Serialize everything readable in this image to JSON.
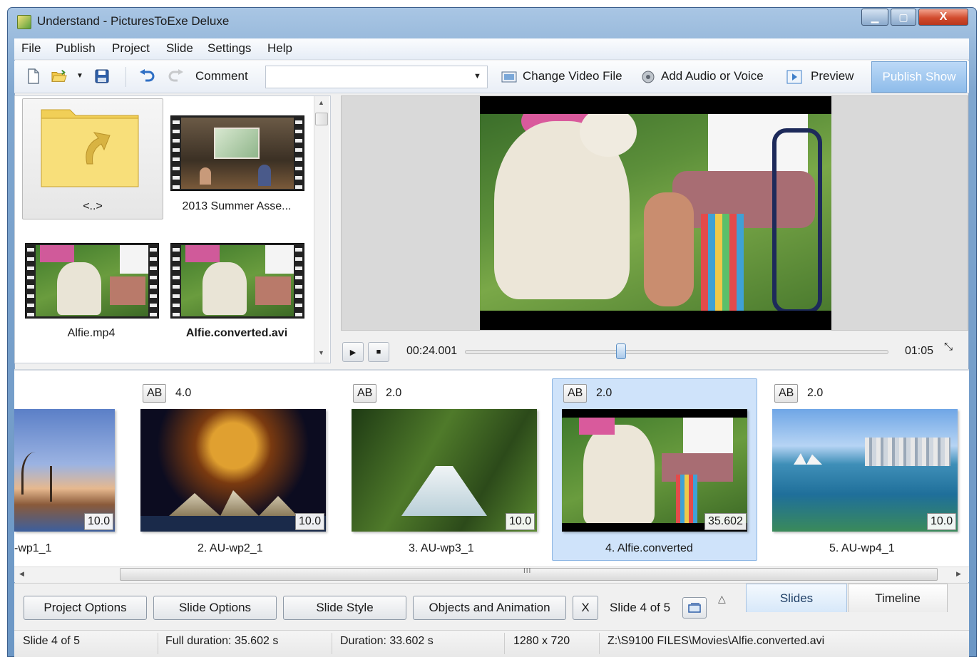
{
  "window": {
    "title": "Understand - PicturesToExe Deluxe",
    "min": "▁",
    "max": "▢",
    "close": "X"
  },
  "menu": [
    "File",
    "Publish",
    "Project",
    "Slide",
    "Settings",
    "Help"
  ],
  "toolbar": {
    "comment_label": "Comment",
    "comment_value": "",
    "change_video": "Change Video File",
    "add_audio": "Add Audio or Voice",
    "preview": "Preview",
    "publish_show": "Publish Show"
  },
  "files": [
    {
      "name": "<..>",
      "type": "parent-folder"
    },
    {
      "name": "2013 Summer Asse..."
    },
    {
      "name": "Alfie.mp4"
    },
    {
      "name": "Alfie.converted.avi",
      "selected": true
    }
  ],
  "player": {
    "current_time": "00:24.001",
    "total_time": "01:05",
    "position_fraction": 0.37
  },
  "slides": [
    {
      "name": "-wp1_1",
      "time": "10.0"
    },
    {
      "ab": "AB",
      "transition": "4.0",
      "name": "2. AU-wp2_1",
      "time": "10.0"
    },
    {
      "ab": "AB",
      "transition": "2.0",
      "name": "3. AU-wp3_1",
      "time": "10.0"
    },
    {
      "ab": "AB",
      "transition": "2.0",
      "name": "4. Alfie.converted",
      "time": "35.602",
      "selected": true
    },
    {
      "ab": "AB",
      "transition": "2.0",
      "name": "5. AU-wp4_1",
      "time": "10.0"
    }
  ],
  "bottom": {
    "project_options": "Project Options",
    "slide_options": "Slide Options",
    "slide_style": "Slide Style",
    "objects_animation": "Objects and Animation",
    "close_x": "X",
    "slide_counter": "Slide 4 of 5",
    "tab_slides": "Slides",
    "tab_timeline": "Timeline"
  },
  "status": {
    "slide": "Slide 4 of 5",
    "full_duration": "Full duration: 35.602 s",
    "duration": "Duration: 33.602 s",
    "resolution": "1280 x 720",
    "path": "Z:\\S9100 FILES\\Movies\\Alfie.converted.avi"
  },
  "colors": {
    "accent": "#8ebcea",
    "selection": "#cfe3fa",
    "frame": "#7fa6cf"
  }
}
